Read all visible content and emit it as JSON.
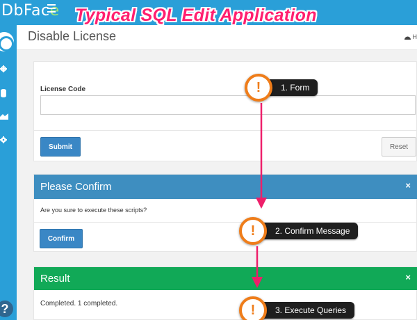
{
  "app": {
    "logo_main": "DbFac",
    "logo_accent": "e",
    "banner": "Typical SQL Edit Application"
  },
  "header": {
    "title": "Disable License",
    "home_label": "H"
  },
  "sidebar": {
    "items": [
      {
        "icon": "gear-icon"
      },
      {
        "icon": "database-icon"
      },
      {
        "icon": "area-chart-icon"
      },
      {
        "icon": "cog-icon"
      }
    ],
    "help_label": "?"
  },
  "form": {
    "label": "License Code",
    "value": "",
    "submit_label": "Submit",
    "reset_label": "Reset"
  },
  "confirm": {
    "title": "Please Confirm",
    "close": "×",
    "message": "Are you sure to execute these scripts?",
    "button_label": "Confirm"
  },
  "result": {
    "title": "Result",
    "close": "×",
    "message": "Completed. 1 completed."
  },
  "annotations": {
    "mark": "!",
    "step1": "1. Form",
    "step2": "2. Confirm Message",
    "step3": "3. Execute Queries",
    "arrow_color": "#ee1f6a",
    "ring_color": "#ef7d1a"
  },
  "colors": {
    "topbar": "#2a9fd8",
    "confirm_header": "#3e8ec0",
    "result_header": "#11a957",
    "primary_button": "#3a87c5"
  }
}
